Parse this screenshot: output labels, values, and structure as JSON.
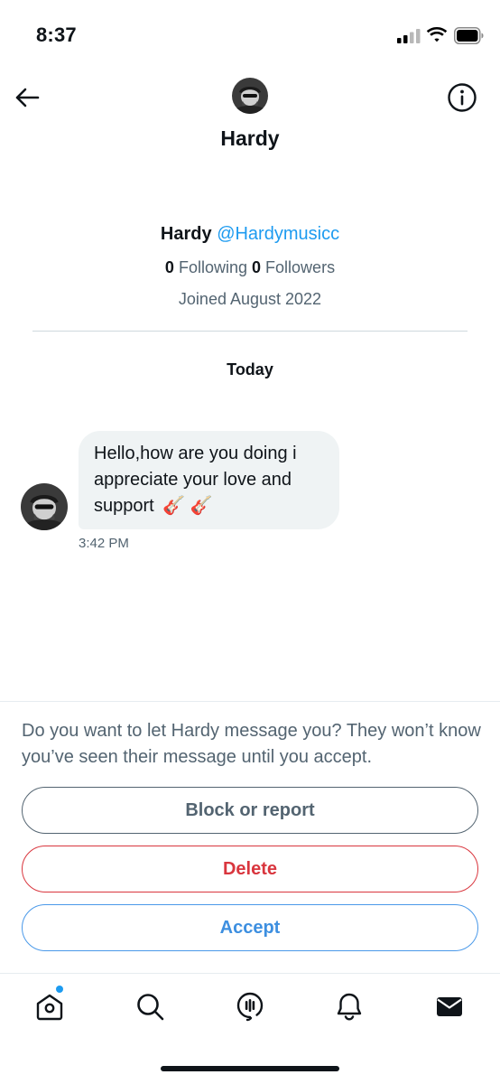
{
  "status_bar": {
    "time": "8:37"
  },
  "header": {
    "title": "Hardy",
    "back_icon": "arrow-left-icon",
    "info_icon": "info-circle-icon"
  },
  "profile": {
    "name": "Hardy",
    "handle": "@Hardymusicc",
    "following_count": "0",
    "following_label": "Following",
    "followers_count": "0",
    "followers_label": "Followers",
    "joined": "Joined August 2022"
  },
  "conversation": {
    "day_label": "Today",
    "messages": [
      {
        "text": "Hello,how are you doing i appreciate your love and support",
        "emoji": "🎸 🎸",
        "time": "3:42 PM"
      }
    ]
  },
  "request": {
    "prompt": "Do you want to let Hardy message you? They won’t know you’ve seen their message until you accept.",
    "block_label": "Block or report",
    "delete_label": "Delete",
    "accept_label": "Accept"
  },
  "bottom_nav": {
    "items": [
      "home-icon",
      "search-icon",
      "spaces-icon",
      "notifications-icon",
      "messages-icon"
    ]
  },
  "colors": {
    "accent": "#1d9bf0",
    "delete": "#d9363e",
    "muted_text": "#536471",
    "bubble": "#eff3f4"
  }
}
